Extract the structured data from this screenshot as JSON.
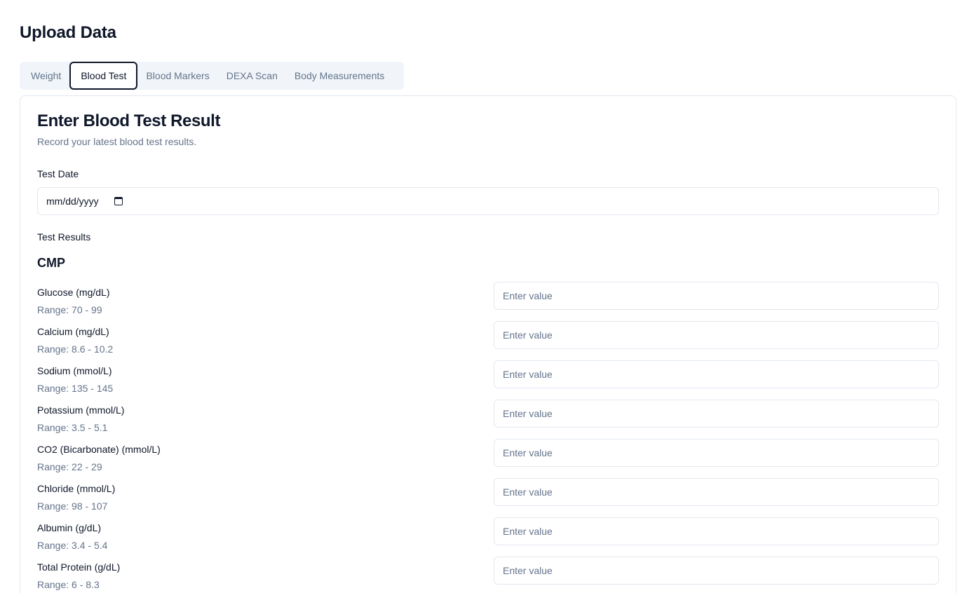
{
  "page_title": "Upload Data",
  "tabs": [
    {
      "label": "Weight",
      "active": false
    },
    {
      "label": "Blood Test",
      "active": true
    },
    {
      "label": "Blood Markers",
      "active": false
    },
    {
      "label": "DEXA Scan",
      "active": false
    },
    {
      "label": "Body Measurements",
      "active": false
    }
  ],
  "card": {
    "title": "Enter Blood Test Result",
    "subtitle": "Record your latest blood test results.",
    "test_date_label": "Test Date",
    "test_date_placeholder": "mm/dd/yyyy",
    "results_label": "Test Results",
    "section_title": "CMP"
  },
  "results": [
    {
      "name": "Glucose (mg/dL)",
      "range": "Range: 70 - 99",
      "placeholder": "Enter value"
    },
    {
      "name": "Calcium (mg/dL)",
      "range": "Range: 8.6 - 10.2",
      "placeholder": "Enter value"
    },
    {
      "name": "Sodium (mmol/L)",
      "range": "Range: 135 - 145",
      "placeholder": "Enter value"
    },
    {
      "name": "Potassium (mmol/L)",
      "range": "Range: 3.5 - 5.1",
      "placeholder": "Enter value"
    },
    {
      "name": "CO2 (Bicarbonate) (mmol/L)",
      "range": "Range: 22 - 29",
      "placeholder": "Enter value"
    },
    {
      "name": "Chloride (mmol/L)",
      "range": "Range: 98 - 107",
      "placeholder": "Enter value"
    },
    {
      "name": "Albumin (g/dL)",
      "range": "Range: 3.4 - 5.4",
      "placeholder": "Enter value"
    },
    {
      "name": "Total Protein (g/dL)",
      "range": "Range: 6 - 8.3",
      "placeholder": "Enter value"
    }
  ]
}
